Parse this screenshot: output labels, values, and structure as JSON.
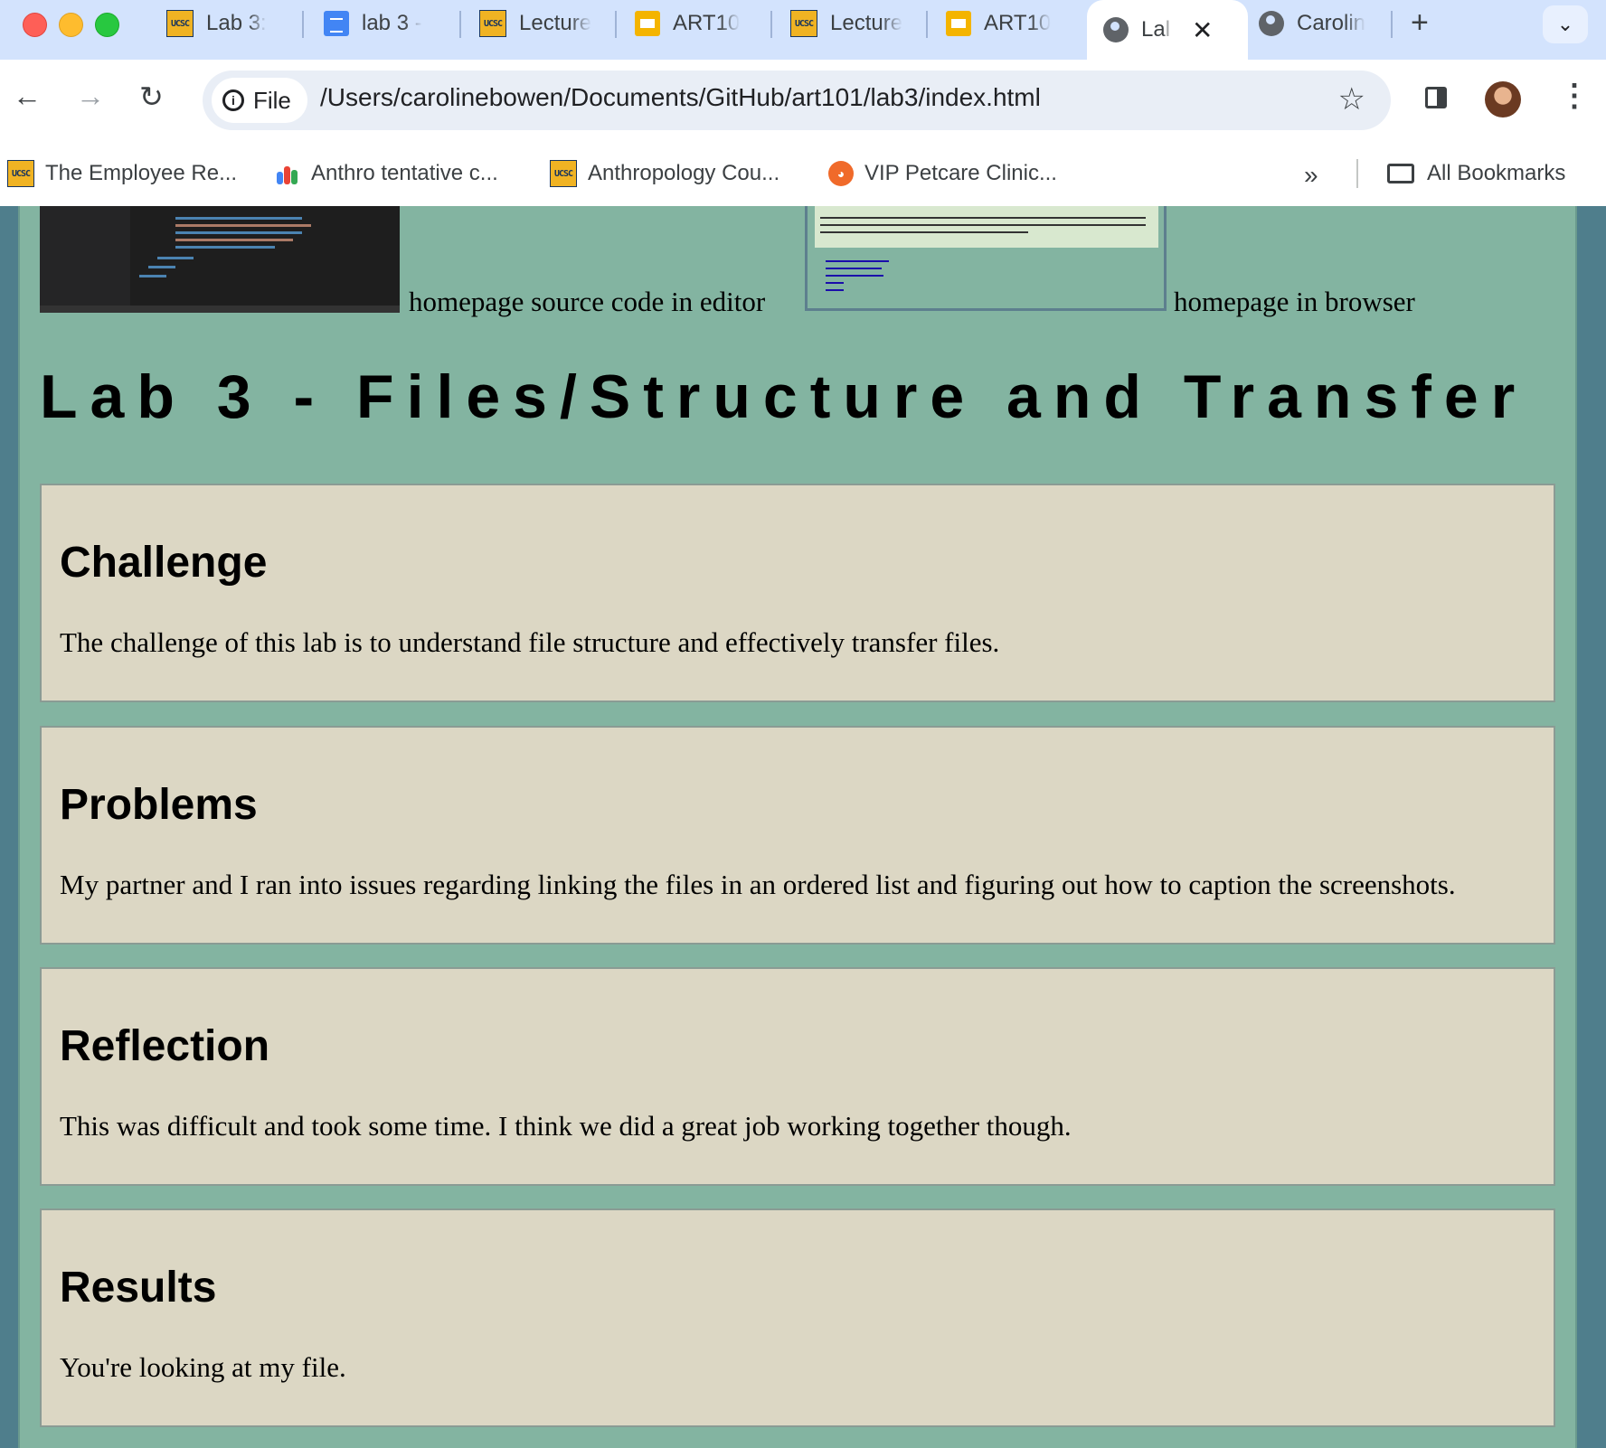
{
  "browser": {
    "tabs": [
      {
        "label": "Lab 3:",
        "icon": "ucsc-favicon"
      },
      {
        "label": "lab 3 -",
        "icon": "google-docs-favicon"
      },
      {
        "label": "Lecture",
        "icon": "ucsc-favicon"
      },
      {
        "label": "ART10",
        "icon": "google-slides-favicon"
      },
      {
        "label": "Lecture",
        "icon": "ucsc-favicon"
      },
      {
        "label": "ART10",
        "icon": "google-slides-favicon"
      },
      {
        "label": "Lal",
        "icon": "globe-favicon",
        "active": true
      },
      {
        "label": "Carolin",
        "icon": "globe-favicon"
      }
    ],
    "omnibox": {
      "chip_label": "File",
      "url": "/Users/carolinebowen/Documents/GitHub/art101/lab3/index.html"
    },
    "bookmarks": [
      {
        "label": "The Employee Re...",
        "icon": "ucsc-favicon"
      },
      {
        "label": "Anthro tentative c...",
        "icon": "people-favicon"
      },
      {
        "label": "Anthropology Cou...",
        "icon": "ucsc-favicon"
      },
      {
        "label": "VIP Petcare Clinic...",
        "icon": "vip-favicon"
      }
    ],
    "all_bookmarks_label": "All Bookmarks",
    "more_bookmarks_glyph": "»",
    "ucsc_favicon_text": "UCSC"
  },
  "page": {
    "screenshot_captions": {
      "editor": "homepage source code in editor",
      "browser": "homepage in browser"
    },
    "title": "Lab 3 - Files/Structure and Transfer",
    "sections": [
      {
        "heading": "Challenge",
        "body": "The challenge of this lab is to understand file structure and effectively transfer files."
      },
      {
        "heading": "Problems",
        "body": "My partner and I ran into issues regarding linking the files in an ordered list and figuring out how to caption the screenshots."
      },
      {
        "heading": "Reflection",
        "body": "This was difficult and took some time. I think we did a great job working together though."
      },
      {
        "heading": "Results",
        "body": "You're looking at my file."
      }
    ]
  },
  "colors": {
    "page_bg": "#83b4a1",
    "box_bg": "#dcd7c4",
    "outer_bg": "#4f7e8c",
    "tabstrip_bg": "#d3e3fd"
  }
}
